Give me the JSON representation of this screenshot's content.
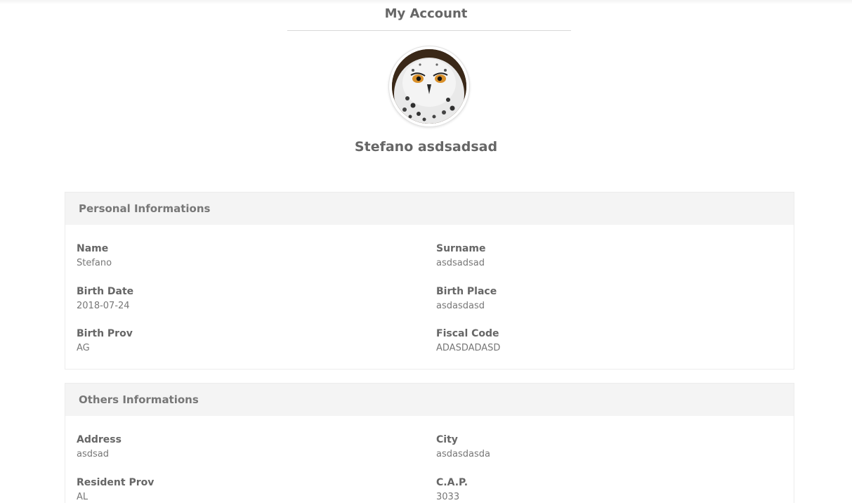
{
  "page": {
    "title": "My Account"
  },
  "profile": {
    "full_name": "Stefano asdsadsad",
    "avatar_icon": "owl-avatar-icon"
  },
  "personal": {
    "header": "Personal Informations",
    "fields": [
      {
        "label": "Name",
        "value": "Stefano"
      },
      {
        "label": "Surname",
        "value": "asdsadsad"
      },
      {
        "label": "Birth Date",
        "value": "2018-07-24"
      },
      {
        "label": "Birth Place",
        "value": "asdasdasd"
      },
      {
        "label": "Birth Prov",
        "value": "AG"
      },
      {
        "label": "Fiscal Code",
        "value": "ADASDADASD"
      }
    ]
  },
  "others": {
    "header": "Others Informations",
    "fields": [
      {
        "label": "Address",
        "value": "asdsad"
      },
      {
        "label": "City",
        "value": "asdasdasda"
      },
      {
        "label": "Resident Prov",
        "value": "AL"
      },
      {
        "label": "C.A.P.",
        "value": "3033"
      }
    ]
  },
  "colors": {
    "panel_header_bg": "#f4f4f4",
    "text_primary": "#666666",
    "text_secondary": "#777777"
  }
}
